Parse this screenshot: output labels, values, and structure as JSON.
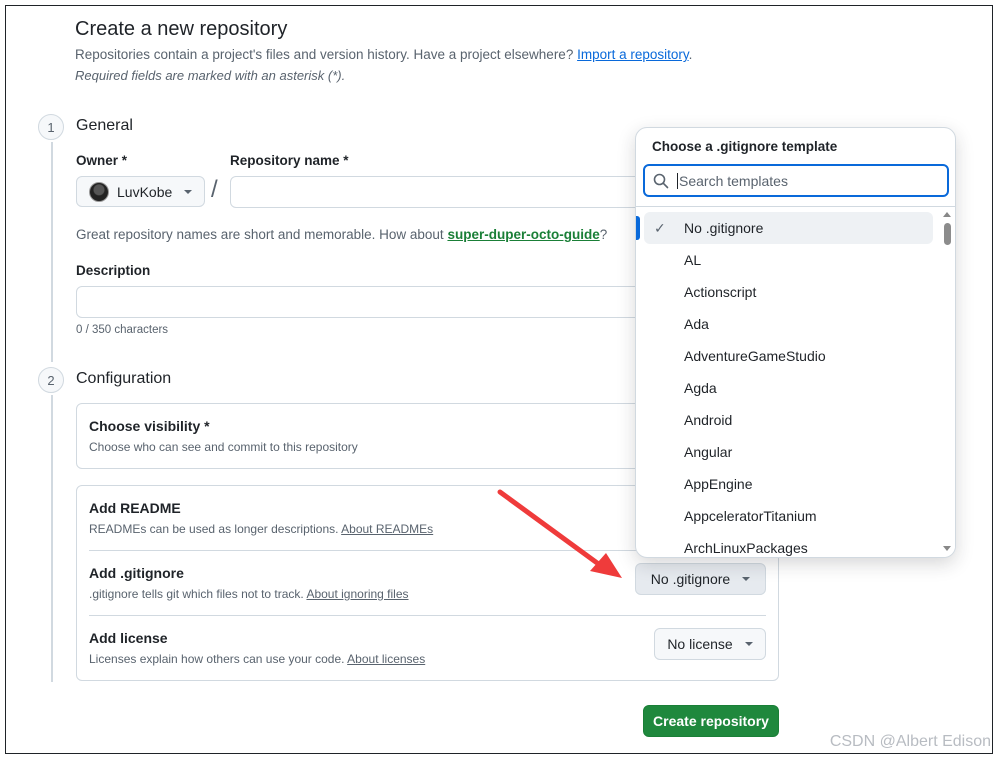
{
  "header": {
    "title": "Create a new repository",
    "intro_text": "Repositories contain a project's files and version history. Have a project elsewhere?",
    "import_link": "Import a repository",
    "intro_period": ".",
    "required_note": "Required fields are marked with an asterisk (*)."
  },
  "general": {
    "step": "1",
    "title": "General",
    "owner_label": "Owner *",
    "owner_value": "LuvKobe",
    "slash": "/",
    "repo_name_label": "Repository name *",
    "repo_name_value": "",
    "name_hint": "Great repository names are short and memorable. How about",
    "name_suggestion": "super-duper-octo-guide",
    "name_hint_end": "?",
    "description_label": "Description",
    "description_value": "",
    "char_count": "0 / 350 characters"
  },
  "configuration": {
    "step": "2",
    "title": "Configuration",
    "visibility": {
      "title": "Choose visibility *",
      "desc": "Choose who can see and commit to this repository"
    },
    "readme": {
      "title": "Add README",
      "desc": "READMEs can be used as longer descriptions.",
      "link": "About READMEs"
    },
    "gitignore": {
      "title": "Add .gitignore",
      "desc": ".gitignore tells git which files not to track.",
      "link": "About ignoring files",
      "button": "No .gitignore"
    },
    "license": {
      "title": "Add license",
      "desc": "Licenses explain how others can use your code.",
      "link": "About licenses",
      "button": "No license"
    }
  },
  "create_button": "Create repository",
  "gitignore_dropdown": {
    "title": "Choose a .gitignore template",
    "search_placeholder": "Search templates",
    "items": [
      {
        "label": "No .gitignore",
        "selected": true
      },
      {
        "label": "AL"
      },
      {
        "label": "Actionscript"
      },
      {
        "label": "Ada"
      },
      {
        "label": "AdventureGameStudio"
      },
      {
        "label": "Agda"
      },
      {
        "label": "Android"
      },
      {
        "label": "Angular"
      },
      {
        "label": "AppEngine"
      },
      {
        "label": "AppceleratorTitanium"
      },
      {
        "label": "ArchLinuxPackages"
      }
    ],
    "check_icon": "✓"
  },
  "watermark": "CSDN @Albert Edison",
  "colors": {
    "accent": "#0969da",
    "primary_button": "#1f883d",
    "annotation_arrow": "#ef3b3b"
  }
}
